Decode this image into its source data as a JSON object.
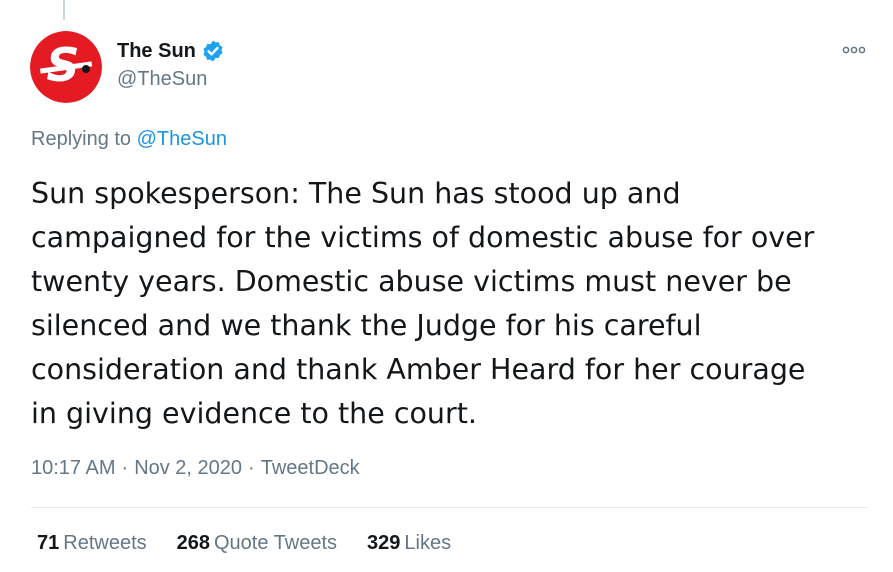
{
  "tweet": {
    "author": {
      "display_name": "The Sun",
      "handle": "@TheSun",
      "verified": true,
      "avatar_icon": "the-sun-logo",
      "avatar_color": "#e41b23"
    },
    "replying_to_label": "Replying to",
    "replying_to_handle": "@TheSun",
    "text_lines": [
      "Sun spokesperson: The Sun has stood up and",
      "campaigned for the victims of domestic abuse for over",
      "twenty years. Domestic abuse victims must never be",
      "silenced and we thank the Judge for his careful",
      "consideration and thank Amber Heard for her courage",
      "in giving evidence to the court."
    ],
    "time": "10:17 AM",
    "date": "Nov 2, 2020",
    "source": "TweetDeck",
    "separator": "·",
    "stats": {
      "retweets_count": "71",
      "retweets_label": "Retweets",
      "quotes_count": "268",
      "quotes_label": "Quote Tweets",
      "likes_count": "329",
      "likes_label": "Likes"
    },
    "colors": {
      "link": "#1b95e0",
      "verified": "#1da1f2",
      "secondary_text": "#657786"
    }
  }
}
